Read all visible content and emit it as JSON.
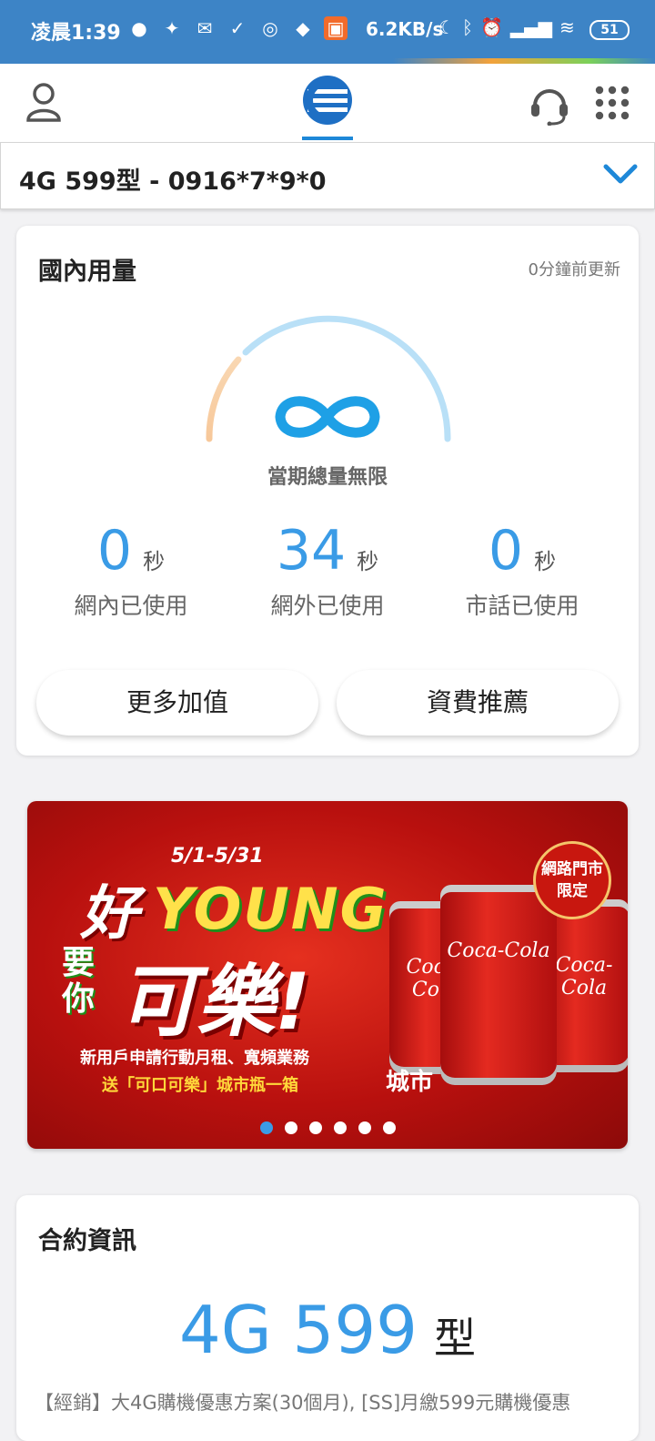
{
  "status_bar": {
    "time": "凌晨1:39",
    "notification_icons": [
      "line-icon",
      "pin-icon",
      "mail-icon",
      "checklist-icon",
      "badge-51-icon",
      "drop-icon",
      "app-icon"
    ],
    "network_speed": "6.2KB/s",
    "battery": "51"
  },
  "header": {
    "logo": "chunghwa-telecom-logo",
    "accent_color": "#1e88d8"
  },
  "plan_selector": {
    "label": "4G 599型 - 0916*7*9*0"
  },
  "usage": {
    "title": "國內用量",
    "updated": "0分鐘前更新",
    "gauge_label": "當期總量無限",
    "stats": [
      {
        "value": "0",
        "unit": "秒",
        "label": "網內已使用"
      },
      {
        "value": "34",
        "unit": "秒",
        "label": "網外已使用"
      },
      {
        "value": "0",
        "unit": "秒",
        "label": "市話已使用"
      }
    ],
    "buttons": {
      "more_addons": "更多加值",
      "recommend": "資費推薦"
    }
  },
  "banner": {
    "date": "5/1-5/31",
    "headline_hao": "好",
    "headline_young": "YOUNG",
    "headline_yaoni": "要你",
    "headline_kele": "可樂!",
    "line1": "新用戶申請行動月租、寬頻業務",
    "line2": "送「可口可樂」城市瓶一箱",
    "badge": "網路門市限定",
    "can_brand": "Coca-Cola",
    "city_text": "城市",
    "slide_count": 6,
    "active_slide": 1
  },
  "contract": {
    "title": "合約資訊",
    "plan_number": "4G 599",
    "plan_suffix": "型",
    "description": "【經銷】大4G購機優惠方案(30個月), [SS]月繳599元購機優惠"
  }
}
